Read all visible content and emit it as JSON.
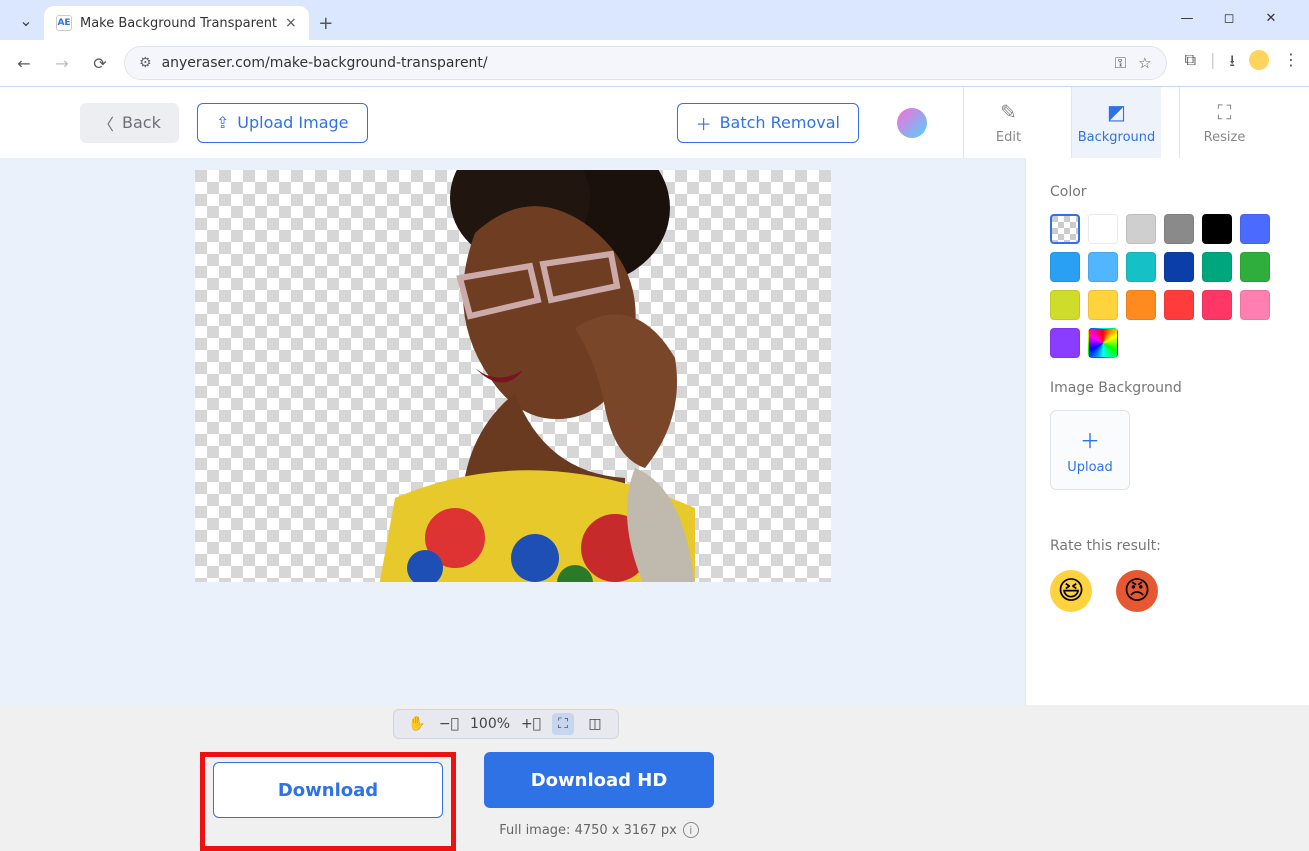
{
  "browser": {
    "tab_title": "Make Background Transparent",
    "url": "anyeraser.com/make-background-transparent/"
  },
  "header": {
    "back_label": "Back",
    "upload_label": "Upload Image",
    "batch_label": "Batch Removal",
    "tabs": {
      "edit": "Edit",
      "background": "Background",
      "resize": "Resize"
    }
  },
  "zoom": {
    "level": "100%"
  },
  "download": {
    "plain": "Download",
    "hd": "Download HD",
    "full_image": "Full image: 4750 x 3167 px"
  },
  "sidebar": {
    "color_label": "Color",
    "image_bg_label": "Image Background",
    "upload_label": "Upload",
    "rate_label": "Rate this result:",
    "colors": [
      "transparent",
      "#ffffff",
      "#cfcfcf",
      "#8a8a8a",
      "#000000",
      "#4b6bff",
      "#2aa0f5",
      "#4fb6ff",
      "#16c0c7",
      "#0b3ea8",
      "#00a67c",
      "#2fae3e",
      "#cfdc2a",
      "#ffd33c",
      "#ff8a1f",
      "#ff3b3b",
      "#ff3764",
      "#ff7fb0",
      "#8a3dff",
      "rainbow"
    ]
  }
}
